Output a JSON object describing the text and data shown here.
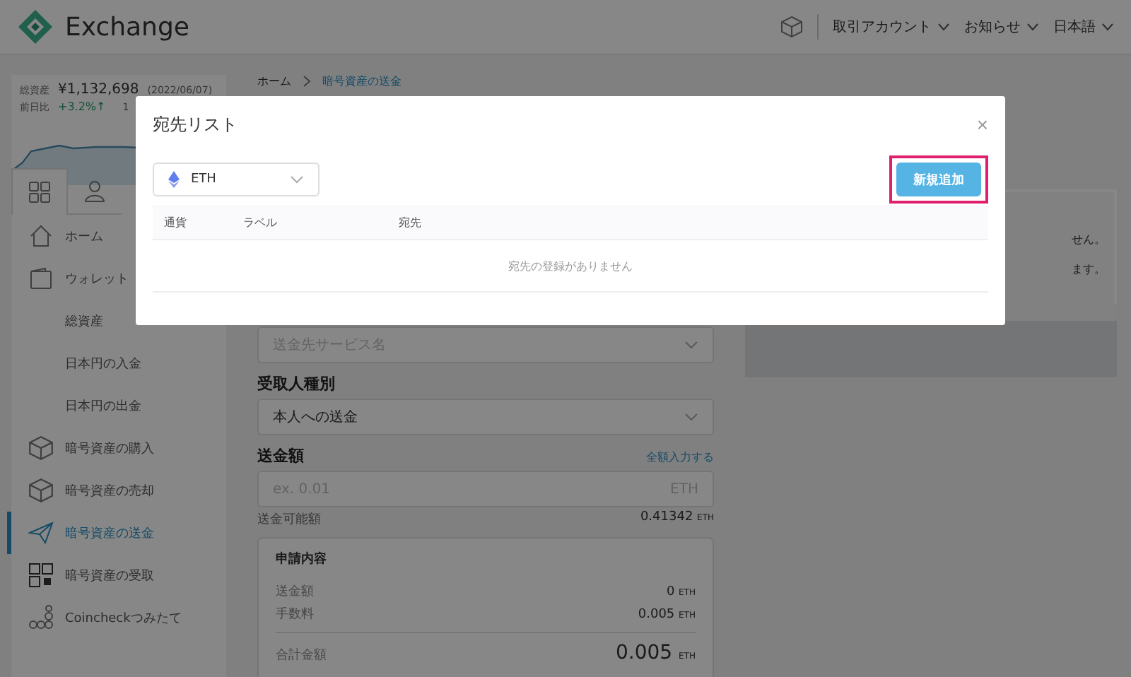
{
  "header": {
    "logo_text": "Exchange",
    "nav": [
      {
        "label": "取引アカウント"
      },
      {
        "label": "お知らせ"
      },
      {
        "label": "日本語"
      }
    ]
  },
  "sidebar": {
    "total_label": "総資産",
    "total_value": "¥1,132,698",
    "total_date": "(2022/06/07)",
    "change_label": "前日比",
    "change_value": "+3.2%↑",
    "period": "1",
    "tabs": [
      {
        "kind": "grid",
        "selected": true
      },
      {
        "kind": "user",
        "selected": false
      }
    ],
    "items": [
      {
        "label": "ホーム",
        "kind": "home",
        "selected": false
      },
      {
        "label": "ウォレット",
        "kind": "wallet",
        "selected": false
      },
      {
        "label": "総資産",
        "kind": "sub",
        "selected": false
      },
      {
        "label": "日本円の入金",
        "kind": "sub",
        "selected": false
      },
      {
        "label": "日本円の出金",
        "kind": "sub",
        "selected": false
      },
      {
        "label": "暗号資産の購入",
        "kind": "cube",
        "selected": false
      },
      {
        "label": "暗号資産の売却",
        "kind": "cube",
        "selected": false
      },
      {
        "label": "暗号資産の送金",
        "kind": "send",
        "selected": true
      },
      {
        "label": "暗号資産の受取",
        "kind": "qr",
        "selected": false
      },
      {
        "label": "Coincheckつみたて",
        "kind": "coins",
        "selected": false
      }
    ]
  },
  "breadcrumb": [
    {
      "label": "ホーム"
    },
    {
      "label": "暗号資産の送金"
    }
  ],
  "form": {
    "service_placeholder": "送金先サービス名",
    "recipient_label": "受取人種別",
    "recipient_value": "本人への送金",
    "amount_label": "送金額",
    "fill_all_link": "全額入力する",
    "amount_placeholder": "ex. 0.01",
    "amount_unit": "ETH",
    "available_label": "送金可能額",
    "available_value": "0.41342",
    "available_unit": "ETH",
    "summary": {
      "title": "申請内容",
      "rows": [
        {
          "label": "送金額",
          "value": "0",
          "unit": "ETH"
        },
        {
          "label": "手数料",
          "value": "0.005",
          "unit": "ETH"
        }
      ],
      "total_label": "合計金額",
      "total_value": "0.005",
      "total_unit": "ETH"
    }
  },
  "right_panel": {
    "notes": [
      "せん。",
      "ます。"
    ]
  },
  "modal": {
    "title": "宛先リスト",
    "close": "×",
    "currency": "ETH",
    "add_button": "新規追加",
    "add_button_highlighted": true,
    "columns": [
      "通貨",
      "ラベル",
      "宛先"
    ],
    "empty_message": "宛先の登録がありません"
  }
}
